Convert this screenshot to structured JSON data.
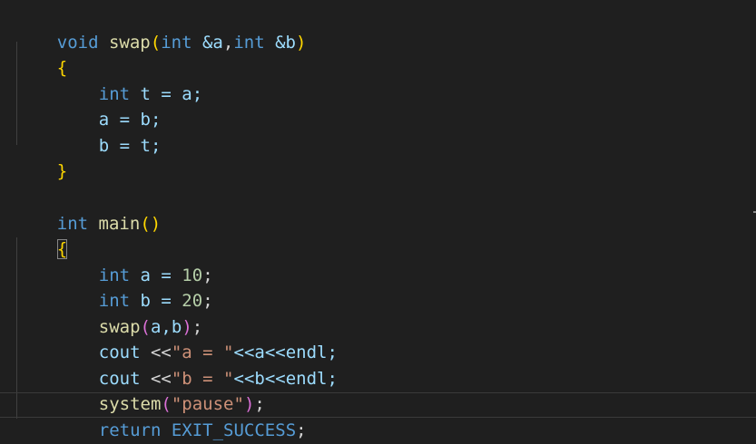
{
  "code": {
    "line1": {
      "kw": "void",
      "fn": "swap",
      "open": "(",
      "int1": "int",
      "p1": " &a",
      "comma": ",",
      "int2": "int",
      "p2": " &b",
      "close": ")"
    },
    "line2": {
      "brace": "{"
    },
    "line3": {
      "kw": "int",
      "rest": " t = a;"
    },
    "line4": {
      "text": "a = b;"
    },
    "line5": {
      "text": "b = t;"
    },
    "line6": {
      "brace": "}"
    },
    "line7": {
      "kw": "int",
      "fn": "main",
      "parens": "()"
    },
    "line8": {
      "brace": "{"
    },
    "line9": {
      "kw": "int",
      "mid": " a = ",
      "num": "10",
      "end": ";"
    },
    "line10": {
      "kw": "int",
      "mid": " b = ",
      "num": "20",
      "end": ";"
    },
    "line11": {
      "fn": "swap",
      "open": "(",
      "args": "a,b",
      "close": ")",
      "end": ";"
    },
    "line12": {
      "fn": "cout",
      "op": " <<",
      "str": "\"a = \"",
      "rest": "<<a<<endl;"
    },
    "line13": {
      "fn": "cout",
      "op": " <<",
      "str": "\"b = \"",
      "rest": "<<b<<endl;"
    },
    "line14": {
      "fn": "system",
      "open": "(",
      "str": "\"pause\"",
      "close": ")",
      "end": ";"
    },
    "line15": {
      "kw": "return",
      "const": "EXIT_SUCCESS",
      "end": ";"
    },
    "line16": {
      "brace": "}"
    }
  },
  "colors": {
    "background": "#1f1f1f",
    "keyword": "#569cd6",
    "function": "#dcdcaa",
    "string": "#ce9178",
    "number": "#b5cea8",
    "brace": "#ffd700",
    "paren_nested": "#da70d6"
  }
}
